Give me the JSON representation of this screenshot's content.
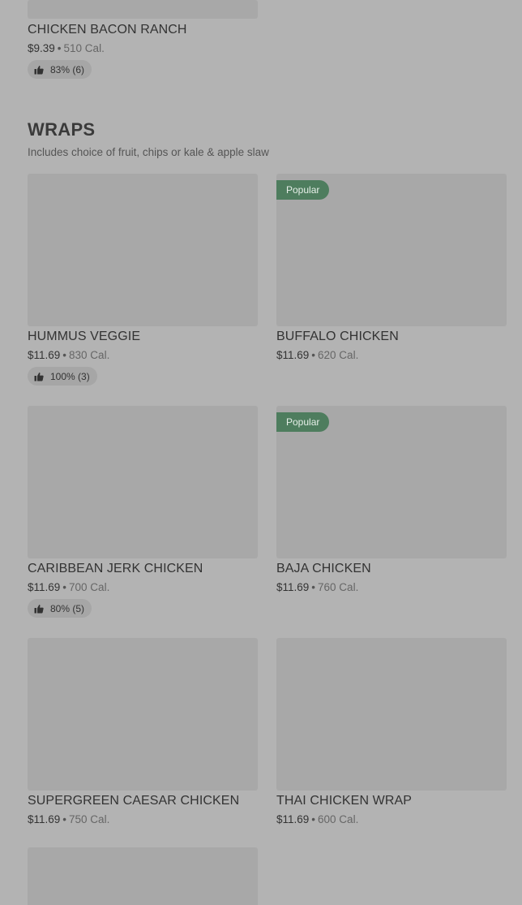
{
  "previous_item": {
    "name": "CHICKEN BACON RANCH",
    "price": "$9.39",
    "calories": "510 Cal.",
    "rating": "83% (6)"
  },
  "section": {
    "title": "WRAPS",
    "subtitle": "Includes choice of fruit, chips or kale & apple slaw"
  },
  "separator": "•",
  "items": [
    {
      "name": "HUMMUS VEGGIE",
      "price": "$11.69",
      "calories": "830 Cal.",
      "rating": "100% (3)",
      "badge": ""
    },
    {
      "name": "BUFFALO CHICKEN",
      "price": "$11.69",
      "calories": "620 Cal.",
      "rating": "",
      "badge": "Popular"
    },
    {
      "name": "CARIBBEAN JERK CHICKEN",
      "price": "$11.69",
      "calories": "700 Cal.",
      "rating": "80% (5)",
      "badge": ""
    },
    {
      "name": "BAJA CHICKEN",
      "price": "$11.69",
      "calories": "760 Cal.",
      "rating": "",
      "badge": "Popular"
    },
    {
      "name": "SUPERGREEN CAESAR CHICKEN",
      "price": "$11.69",
      "calories": "750 Cal.",
      "rating": "",
      "badge": ""
    },
    {
      "name": "THAI CHICKEN WRAP",
      "price": "$11.69",
      "calories": "600 Cal.",
      "rating": "",
      "badge": ""
    }
  ],
  "colors": {
    "background": "#b3b3b3",
    "image_placeholder": "#a8a8a8",
    "popular_badge": "#4e7d5e",
    "rating_pill": "#a6a6a6"
  },
  "icons": {
    "rating": "thumbs-up-icon"
  }
}
